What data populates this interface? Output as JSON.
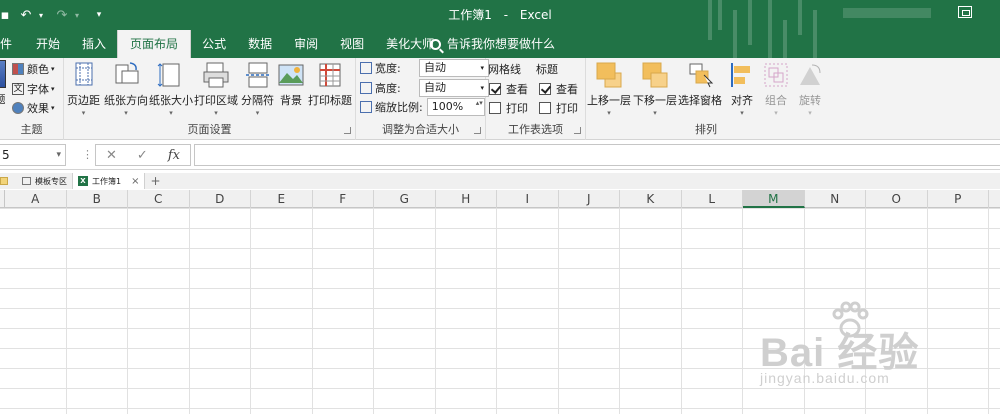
{
  "window": {
    "title": "工作簿1",
    "app_name": "Excel"
  },
  "quick_access": {
    "undo_icon": "undo-icon",
    "redo_icon": "redo-icon",
    "customize_icon": "customize-qat-icon"
  },
  "tabs": [
    {
      "label": "件"
    },
    {
      "label": "开始"
    },
    {
      "label": "插入"
    },
    {
      "label": "页面布局",
      "active": true
    },
    {
      "label": "公式"
    },
    {
      "label": "数据"
    },
    {
      "label": "审阅"
    },
    {
      "label": "视图"
    },
    {
      "label": "美化大师"
    }
  ],
  "tell_me": {
    "placeholder": "告诉我你想要做什么"
  },
  "ribbon": {
    "themes": {
      "label": "主题",
      "theme_label": "题",
      "colors": "颜色",
      "fonts": "字体",
      "effects": "效果"
    },
    "page_setup": {
      "label": "页面设置",
      "buttons": [
        "页边距",
        "纸张方向",
        "纸张大小",
        "打印区域",
        "分隔符",
        "背景",
        "打印标题"
      ]
    },
    "scale_to_fit": {
      "label": "调整为合适大小",
      "width_label": "宽度:",
      "width_value": "自动",
      "height_label": "高度:",
      "height_value": "自动",
      "scale_label": "缩放比例:",
      "scale_value": "100%"
    },
    "sheet_options": {
      "label": "工作表选项",
      "gridlines": "网格线",
      "headings": "标题",
      "view": "查看",
      "print": "打印",
      "gridlines_view": true,
      "gridlines_print": false,
      "headings_view": true,
      "headings_print": false
    },
    "arrange": {
      "label": "排列",
      "buttons": [
        "上移一层",
        "下移一层",
        "选择窗格",
        "对齐",
        "组合",
        "旋转"
      ]
    }
  },
  "formula_bar": {
    "name_box": "5",
    "cancel": "✕",
    "enter": "✓",
    "fx": "fx",
    "value": ""
  },
  "workbook_tabs": [
    {
      "label": "模板专区"
    },
    {
      "label": "工作簿1",
      "active": true,
      "close": "×"
    }
  ],
  "new_tab": "+",
  "columns": [
    "A",
    "B",
    "C",
    "D",
    "E",
    "F",
    "G",
    "H",
    "I",
    "J",
    "K",
    "L",
    "M",
    "N",
    "O",
    "P"
  ],
  "selected_column": "M",
  "watermark": {
    "brand": "Bai 经验",
    "url": "jingyan.baidu.com"
  },
  "colors": {
    "accent": "#217346",
    "ribbon": "#f3f3f3"
  }
}
